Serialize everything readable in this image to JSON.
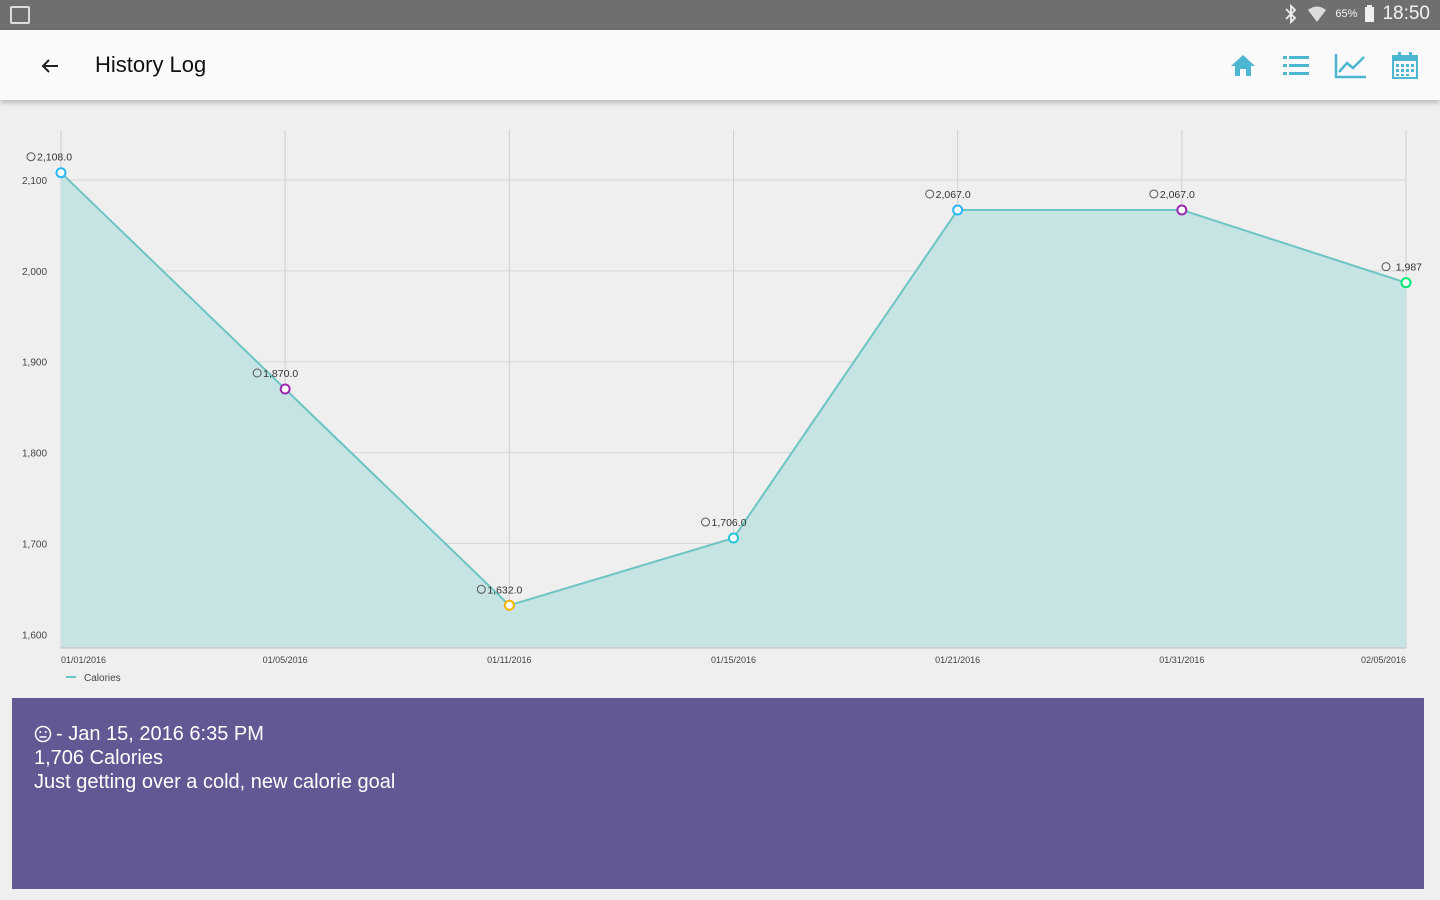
{
  "status_bar": {
    "time": "18:50",
    "battery": "65%",
    "icons": [
      "screenshot-icon",
      "bluetooth-icon",
      "wifi-icon",
      "battery-icon"
    ]
  },
  "app_bar": {
    "title": "History Log",
    "back_icon": "arrow-left-icon",
    "actions": [
      {
        "name": "home-button",
        "icon": "home-icon"
      },
      {
        "name": "list-button",
        "icon": "list-icon"
      },
      {
        "name": "graph-button",
        "icon": "line-chart-icon"
      },
      {
        "name": "calendar-button",
        "icon": "calendar-icon"
      }
    ],
    "accent_color": "#4db6d0"
  },
  "chart_data": {
    "type": "area",
    "x": [
      "01/01/2016",
      "01/05/2016",
      "01/11/2016",
      "01/15/2016",
      "01/21/2016",
      "01/31/2016",
      "02/05/2016"
    ],
    "series": [
      {
        "name": "Calories",
        "values": [
          2108,
          1870,
          1632,
          1706,
          2067,
          2067,
          1987
        ],
        "point_labels": [
          "2,108.0",
          "1,870.0",
          "1,632.0",
          "1,706.0",
          "2,067.0",
          "2,067.0",
          "1,987"
        ],
        "point_colors": [
          "#29b6f6",
          "#9c27b0",
          "#ffb300",
          "#26c6da",
          "#29b6f6",
          "#9c27b0",
          "#00e676"
        ],
        "line_color": "#6cc5c2",
        "fill_color": "#c6e4e3"
      }
    ],
    "y_ticks": [
      "2,100",
      "2,000",
      "1,900",
      "1,800",
      "1,700",
      "1,600"
    ],
    "y_tick_values": [
      2100,
      2000,
      1900,
      1800,
      1700,
      1600
    ],
    "ylim": [
      1585,
      2155
    ],
    "grid": true,
    "legend": "bottom-left"
  },
  "detail": {
    "mood_icon": "neutral-face-icon",
    "header": "- Jan 15, 2016 6:35 PM",
    "calories": "1,706 Calories",
    "note": "Just getting over a cold, new calorie goal",
    "background": "#635893"
  }
}
